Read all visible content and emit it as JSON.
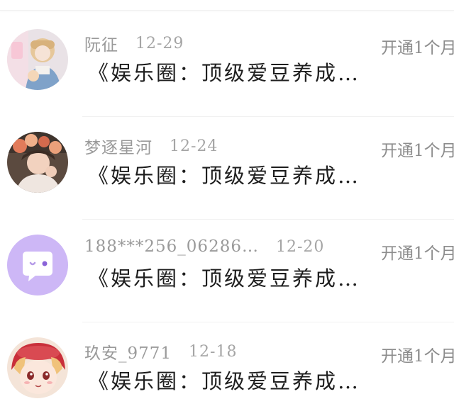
{
  "items": [
    {
      "name": "阮征",
      "date": "12-29",
      "title": "《娱乐圈：顶级爱豆养成…",
      "action": "开通1个月"
    },
    {
      "name": "梦逐星河",
      "date": "12-24",
      "title": "《娱乐圈：顶级爱豆养成…",
      "action": "开通1个月"
    },
    {
      "name": "188***256_06286…",
      "date": "12-20",
      "title": "《娱乐圈：顶级爱豆养成…",
      "action": "开通1个月"
    },
    {
      "name": "玖安_9771",
      "date": "12-18",
      "title": "《娱乐圈：顶级爱豆养成…",
      "action": "开通1个月"
    }
  ],
  "colors": {
    "name_text": "#9a9a9a",
    "title_text": "#1e1e1e",
    "action_text": "#8c8c8c",
    "default_avatar_bg": "#cdb7f6"
  },
  "icons": [
    "photo-avatar",
    "photo-avatar",
    "chat-bubble-avatar-icon",
    "anime-avatar"
  ]
}
